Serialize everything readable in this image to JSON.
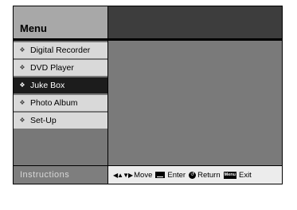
{
  "header": {
    "title": "Menu"
  },
  "sidebar": {
    "items": [
      {
        "label": "Digital Recorder",
        "selected": false
      },
      {
        "label": "DVD Player",
        "selected": false
      },
      {
        "label": "Juke Box",
        "selected": true
      },
      {
        "label": "Photo Album",
        "selected": false
      },
      {
        "label": "Set-Up",
        "selected": false
      }
    ]
  },
  "footer": {
    "instructions_label": "Instructions",
    "hints": {
      "move": "Move",
      "enter": "Enter",
      "return": "Return",
      "menu_key": "Menu",
      "exit": "Exit"
    }
  },
  "icons": {
    "bullet": "diamond-bullet-icon",
    "move": "move-arrows-icon",
    "enter": "enter-key-icon",
    "return": "return-icon",
    "menu": "menu-key-icon"
  }
}
